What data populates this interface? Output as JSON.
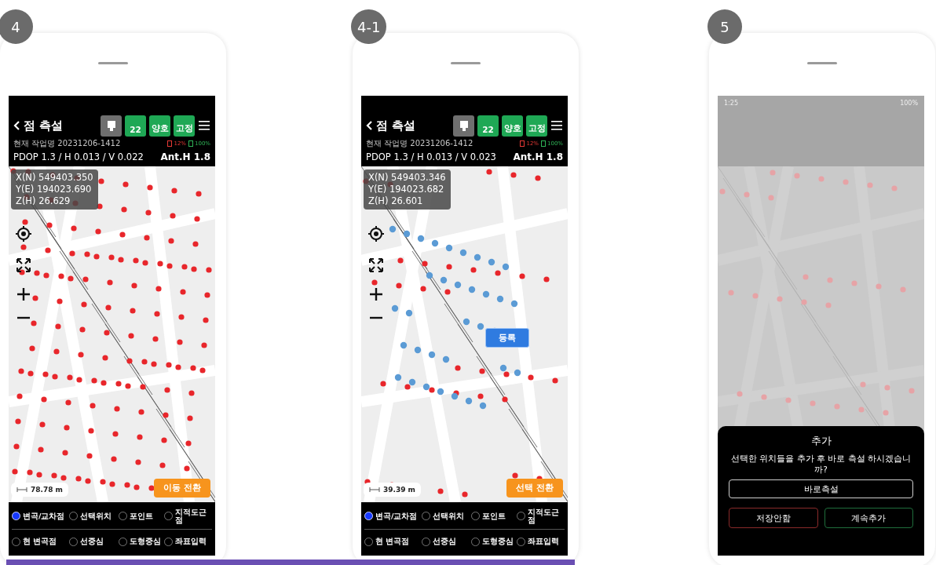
{
  "phones": [
    {
      "step": "4",
      "kind": "measure",
      "header": {
        "title": "점 측설",
        "badges": [
          {
            "kind": "icon"
          },
          {
            "kind": "text",
            "value": "22"
          },
          {
            "kind": "text",
            "value": "양호"
          },
          {
            "kind": "text",
            "value": "고정"
          }
        ],
        "job": "현재 작업명 20231206-1412",
        "readings": [
          {
            "text": "12%",
            "color": "#e53935"
          },
          {
            "text": "100%",
            "color": "#2fb457"
          }
        ],
        "precision": "PDOP 1.3 / H 0.013 / V 0.022",
        "antenna": "Ant.H 1.8"
      },
      "coordinates": [
        "X(N) 549403.350",
        "Y(E) 194023.690",
        "Z(H) 26.629"
      ],
      "markers": [
        {
          "color": "#e8262b"
        }
      ],
      "scale": "78.78 m",
      "mode_button": "이동 전환",
      "options": [
        [
          {
            "label": "변곡/교차점",
            "selected": true
          },
          {
            "label": "선택위치",
            "selected": false
          },
          {
            "label": "포인트",
            "selected": false
          },
          {
            "label": "지적도근점",
            "selected": false
          }
        ],
        [
          {
            "label": "현 변곡점",
            "selected": false
          },
          {
            "label": "선중심",
            "selected": false
          },
          {
            "label": "도형중심",
            "selected": false
          },
          {
            "label": "좌표입력",
            "selected": false
          }
        ]
      ]
    },
    {
      "step": "4-1",
      "kind": "measure",
      "header": {
        "title": "점 측설",
        "badges": [
          {
            "kind": "icon"
          },
          {
            "kind": "text",
            "value": "22"
          },
          {
            "kind": "text",
            "value": "양호"
          },
          {
            "kind": "text",
            "value": "고정"
          }
        ],
        "job": "현재 작업명 20231206-1412",
        "readings": [
          {
            "text": "12%",
            "color": "#e53935"
          },
          {
            "text": "100%",
            "color": "#2fb457"
          }
        ],
        "precision": "PDOP 1.3 / H 0.013 / V 0.023",
        "antenna": "Ant.H 1.8"
      },
      "coordinates": [
        "X(N) 549403.346",
        "Y(E) 194023.682",
        "Z(H) 26.601"
      ],
      "markers": [
        {
          "color": "#e8262b"
        },
        {
          "color": "#5b9bd5"
        }
      ],
      "register_button": "등록",
      "scale": "39.39 m",
      "mode_button": "선택 전환",
      "options": [
        [
          {
            "label": "변곡/교차점",
            "selected": true
          },
          {
            "label": "선택위치",
            "selected": false
          },
          {
            "label": "포인트",
            "selected": false
          },
          {
            "label": "지적도근점",
            "selected": false
          }
        ],
        [
          {
            "label": "현 변곡점",
            "selected": false
          },
          {
            "label": "선중심",
            "selected": false
          },
          {
            "label": "도형중심",
            "selected": false
          },
          {
            "label": "좌표입력",
            "selected": false
          }
        ]
      ]
    },
    {
      "step": "5",
      "kind": "dialog",
      "status_bar": {
        "time": "1:25",
        "battery": "100%"
      },
      "markers": [
        {
          "color": "#e6a3a6"
        }
      ],
      "dialog": {
        "title": "추가",
        "message": "선택한 위치들을 추가 후 바로 측설 하시겠습니까?",
        "buttons": [
          {
            "label": "바로측설",
            "kind": "primary"
          },
          {
            "label": "저장안함",
            "kind": "cancel"
          },
          {
            "label": "계속추가",
            "kind": "confirm"
          }
        ]
      }
    }
  ]
}
